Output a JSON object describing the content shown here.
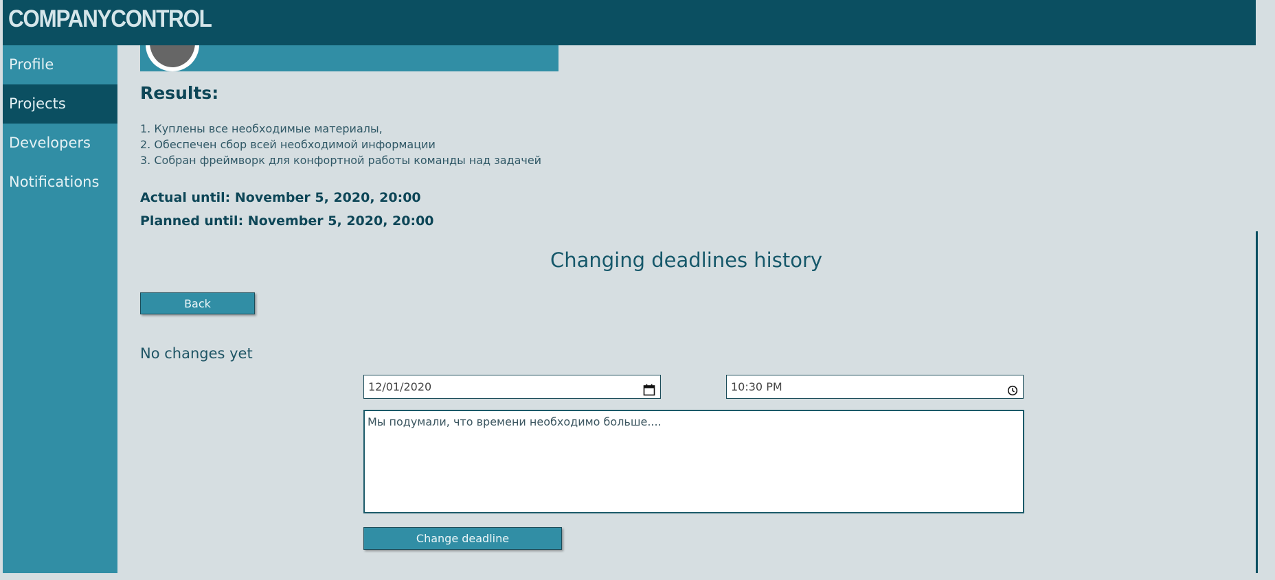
{
  "app": {
    "brand": "COMPANYCONTROL"
  },
  "sidebar": {
    "items": [
      {
        "label": "Profile",
        "active": false
      },
      {
        "label": "Projects",
        "active": true
      },
      {
        "label": "Developers",
        "active": false
      },
      {
        "label": "Notifications",
        "active": false
      }
    ]
  },
  "project": {
    "results_heading": "Results:",
    "results": [
      "1. Куплены все необходимые материалы,",
      "2. Обеспечен сбор всей необходимой информации",
      "3. Собран фреймворк для конфортной работы команды над задачей"
    ],
    "actual_until": "Actual until: November 5, 2020, 20:00",
    "planned_until": "Planned until: November 5, 2020, 20:00"
  },
  "history": {
    "title": "Changing deadlines history",
    "back_label": "Back",
    "empty_text": "No changes yet"
  },
  "form": {
    "date_value": "12/01/2020",
    "time_value": "10:30 PM",
    "reason_value": "Мы подумали, что времени необходимо больше....",
    "submit_label": "Change deadline",
    "date_icon": "calendar-icon",
    "time_icon": "clock-icon"
  },
  "colors": {
    "header": "#0b4f61",
    "sidebar": "#318ea5",
    "sidebar_active": "#0b4f61",
    "background": "#d6dee1",
    "accent_text": "#0d4657"
  }
}
